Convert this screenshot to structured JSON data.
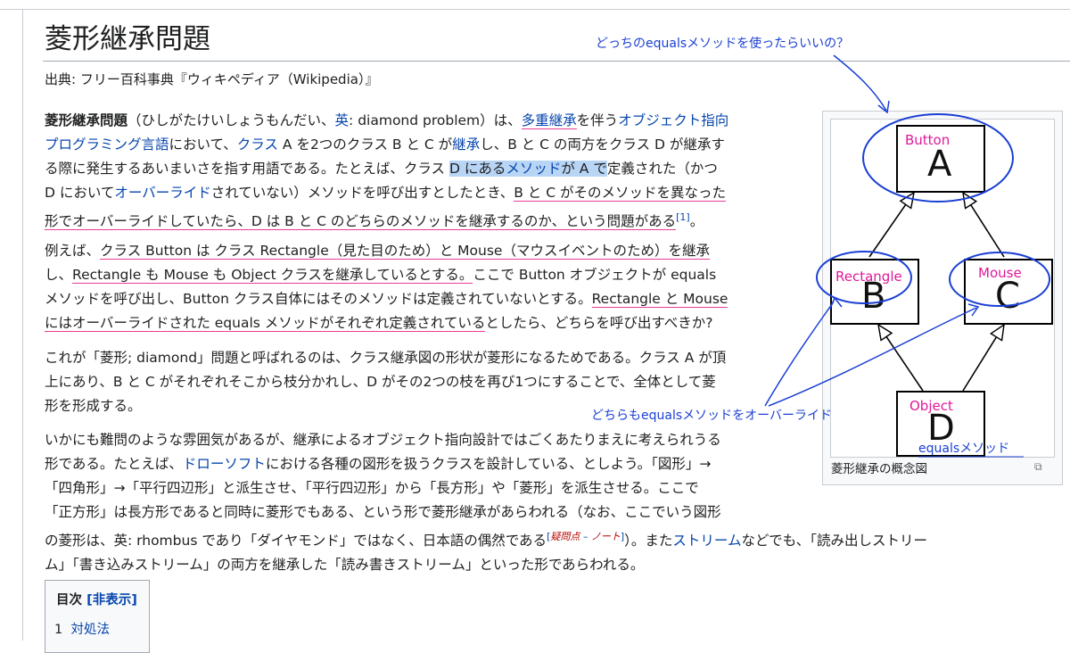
{
  "title": "菱形継承問題",
  "source": "出典: フリー百科事典『ウィキペディア（Wikipedia）』",
  "para1": {
    "l1": [
      "菱形継承問題",
      "（ひしがたけいしょうもんだい、",
      "英",
      ": diamond problem）は、",
      "多重継承",
      "を伴う",
      "オブジェクト指向"
    ],
    "l2": [
      "プログラミング言語",
      "において、",
      "クラス",
      " A を2つのクラス B と C が",
      "継承",
      "し、B と C の両方をクラス D が継承す"
    ],
    "l3": [
      "る際に発生するあいまいさを指す用語である。たとえば、クラス ",
      "D にある",
      "メソッド",
      "が A で",
      "定義された（かつ"
    ],
    "l4": [
      "D において",
      "オーバーライド",
      "されていない）メソッドを呼び出すとしたとき、",
      "B と C がそのメソッドを異なった"
    ],
    "l5": [
      "形でオーバーライドしていたら、D は B と C のどちらのメソッドを継承するのか、という問題がある",
      "[1]",
      "。"
    ]
  },
  "para2": {
    "l1": [
      "例えば、",
      "クラス Button は クラス Rectangle（見た目のため）と Mouse（マウスイベントのため）を継承"
    ],
    "l2": [
      "し、",
      "Rectangle も Mouse も Object クラスを継承しているとする。",
      "ここで Button オブジェクトが equals"
    ],
    "l3": [
      "メソッドを呼び出し、Button クラス自体にはそのメソッドは定義されていないとする。",
      "Rectangle と Mouse"
    ],
    "l4": [
      "にはオーバーライドされた equals メソッドがそれぞれ定義されている",
      "としたら、どちらを呼び出すべきか?"
    ]
  },
  "para3": [
    "これが「菱形; diamond」問題と呼ばれるのは、クラス継承図の形状が菱形になるためである。クラス A が頂",
    "上にあり、B と C がそれぞれそこから枝分かれし、D がその2つの枝を再び1つにすることで、全体として菱",
    "形を形成する。"
  ],
  "para4": {
    "l1": "いかにも難問のような雰囲気があるが、継承によるオブジェクト指向設計ではごくあたりまえに考えられうる",
    "l2": [
      "形である。たとえば、",
      "ドローソフト",
      "における各種の図形を扱うクラスを設計している、としよう。「図形」→"
    ],
    "l3": "「四角形」→「平行四辺形」と派生させ、「平行四辺形」から「長方形」や「菱形」を派生させる。ここで",
    "l4": "「正方形」は長方形であると同時に菱形でもある、という形で菱形継承があらわれる（なお、ここでいう図形",
    "l5": [
      "の菱形は、英: rhombus であり「ダイヤモンド」ではなく、日本語の偶然である",
      "[",
      "疑問点",
      " – ",
      "ノート",
      "]",
      "）。また",
      "ストリーム",
      "などでも、「読み出しストリー"
    ],
    "l6": "ム」「書き込みストリーム」の両方を継承した「読み書きストリーム」といった形であらわれる。"
  },
  "toc": {
    "title": "目次",
    "toggle": "[非表示]",
    "item_num": "1",
    "item_label": "対処法"
  },
  "diagram": {
    "caption": "菱形継承の概念図",
    "letters": {
      "a": "A",
      "b": "B",
      "c": "C",
      "d": "D"
    },
    "handwritten": {
      "button": "Button",
      "rectangle": "Rectangle",
      "mouse": "Mouse",
      "object": "Object",
      "equals_method": "equalsメソッド"
    }
  },
  "annotations": {
    "question": "どっちのequalsメソッドを使ったらいいの？",
    "both_override": "どちらもequalsメソッドをオーバーライド"
  },
  "colors": {
    "link": "#0645ad",
    "annotation_blue": "#1a3fd4",
    "annotation_pink": "#e0189a",
    "highlight": "#b8d5f5"
  }
}
